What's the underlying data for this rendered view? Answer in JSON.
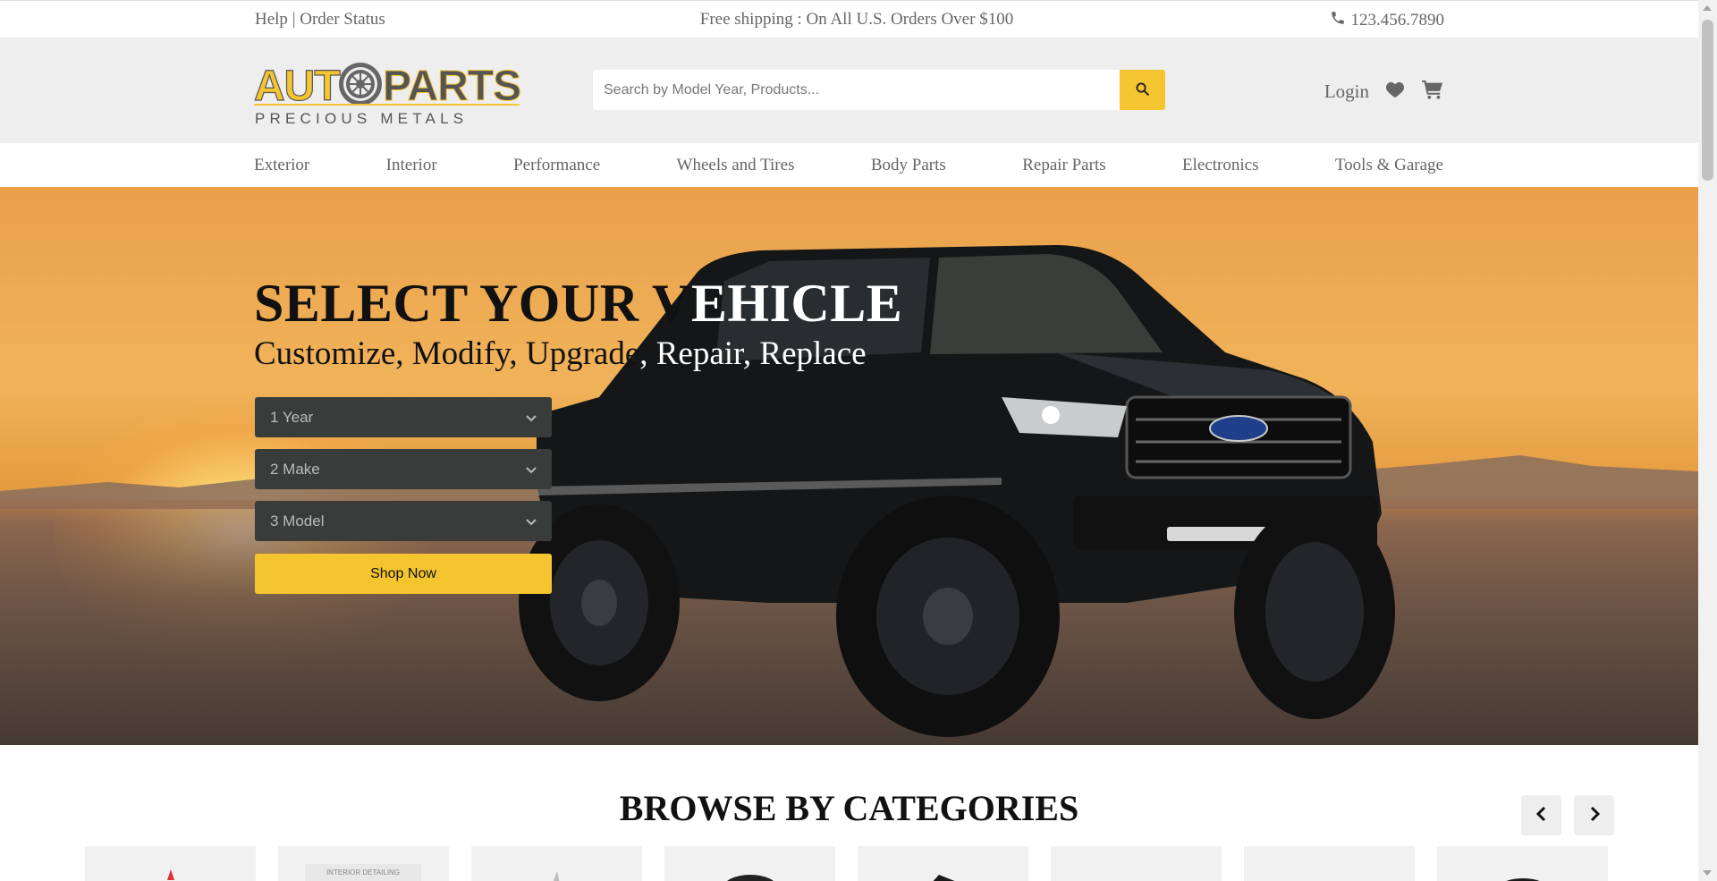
{
  "topbar": {
    "help": "Help",
    "separator": "|",
    "order_status": "Order Status",
    "shipping": "Free shipping : On All U.S. Orders Over $100",
    "phone": "123.456.7890"
  },
  "logo": {
    "word_left": "AUT",
    "word_right": "PARTS",
    "tagline": "PRECIOUS METALS"
  },
  "search": {
    "placeholder": "Search by Model Year, Products...",
    "value": ""
  },
  "header": {
    "login": "Login"
  },
  "nav": {
    "items": [
      "Exterior",
      "Interior",
      "Performance",
      "Wheels and Tires",
      "Body Parts",
      "Repair Parts",
      "Electronics",
      "Tools & Garage"
    ]
  },
  "hero": {
    "title_dark": "SELECT YOUR V",
    "title_light": "EHICLE",
    "subtitle_dark": "Customize, Modify, Upgrade",
    "subtitle_light": ", Repair, Replace",
    "selects": [
      "1 Year",
      "2 Make",
      "3 Model"
    ],
    "shop_button": "Shop Now"
  },
  "categories": {
    "title": "BROWSE BY CATEGORIES",
    "card_label_2": "INTERIOR DETAILING"
  },
  "colors": {
    "accent": "#f5c52f",
    "header_bg": "#eeeeee",
    "select_bg": "#383c3a"
  },
  "icons": [
    "phone-icon",
    "search-icon",
    "heart-icon",
    "cart-icon",
    "chevron-down-icon",
    "chevron-left-icon",
    "chevron-right-icon"
  ]
}
